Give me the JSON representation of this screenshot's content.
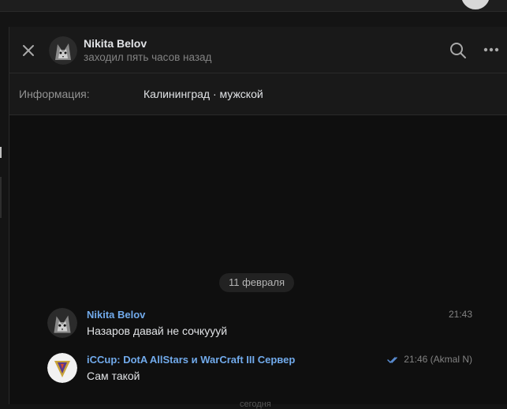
{
  "chat": {
    "contact_name": "Nikita Belov",
    "contact_status": "заходил пять часов назад",
    "info_label": "Информация:",
    "info_value": "Калининград · мужской"
  },
  "date_separator": "11 февраля",
  "today_separator": "сегодня",
  "messages": [
    {
      "author": "Nikita Belov",
      "text": "Назаров давай не сочкуууй",
      "time": "21:43"
    },
    {
      "author": "iCCup: DotA AllStars и WarCraft III Сервер",
      "text": "Сам такой",
      "meta": "21:46 (Akmal N)"
    }
  ],
  "icons": {
    "close": "close-icon",
    "search": "search-icon",
    "more": "more-icon",
    "read": "double-check-icon"
  },
  "colors": {
    "accent": "#71aaeb",
    "read_check": "#5b8fd6"
  }
}
